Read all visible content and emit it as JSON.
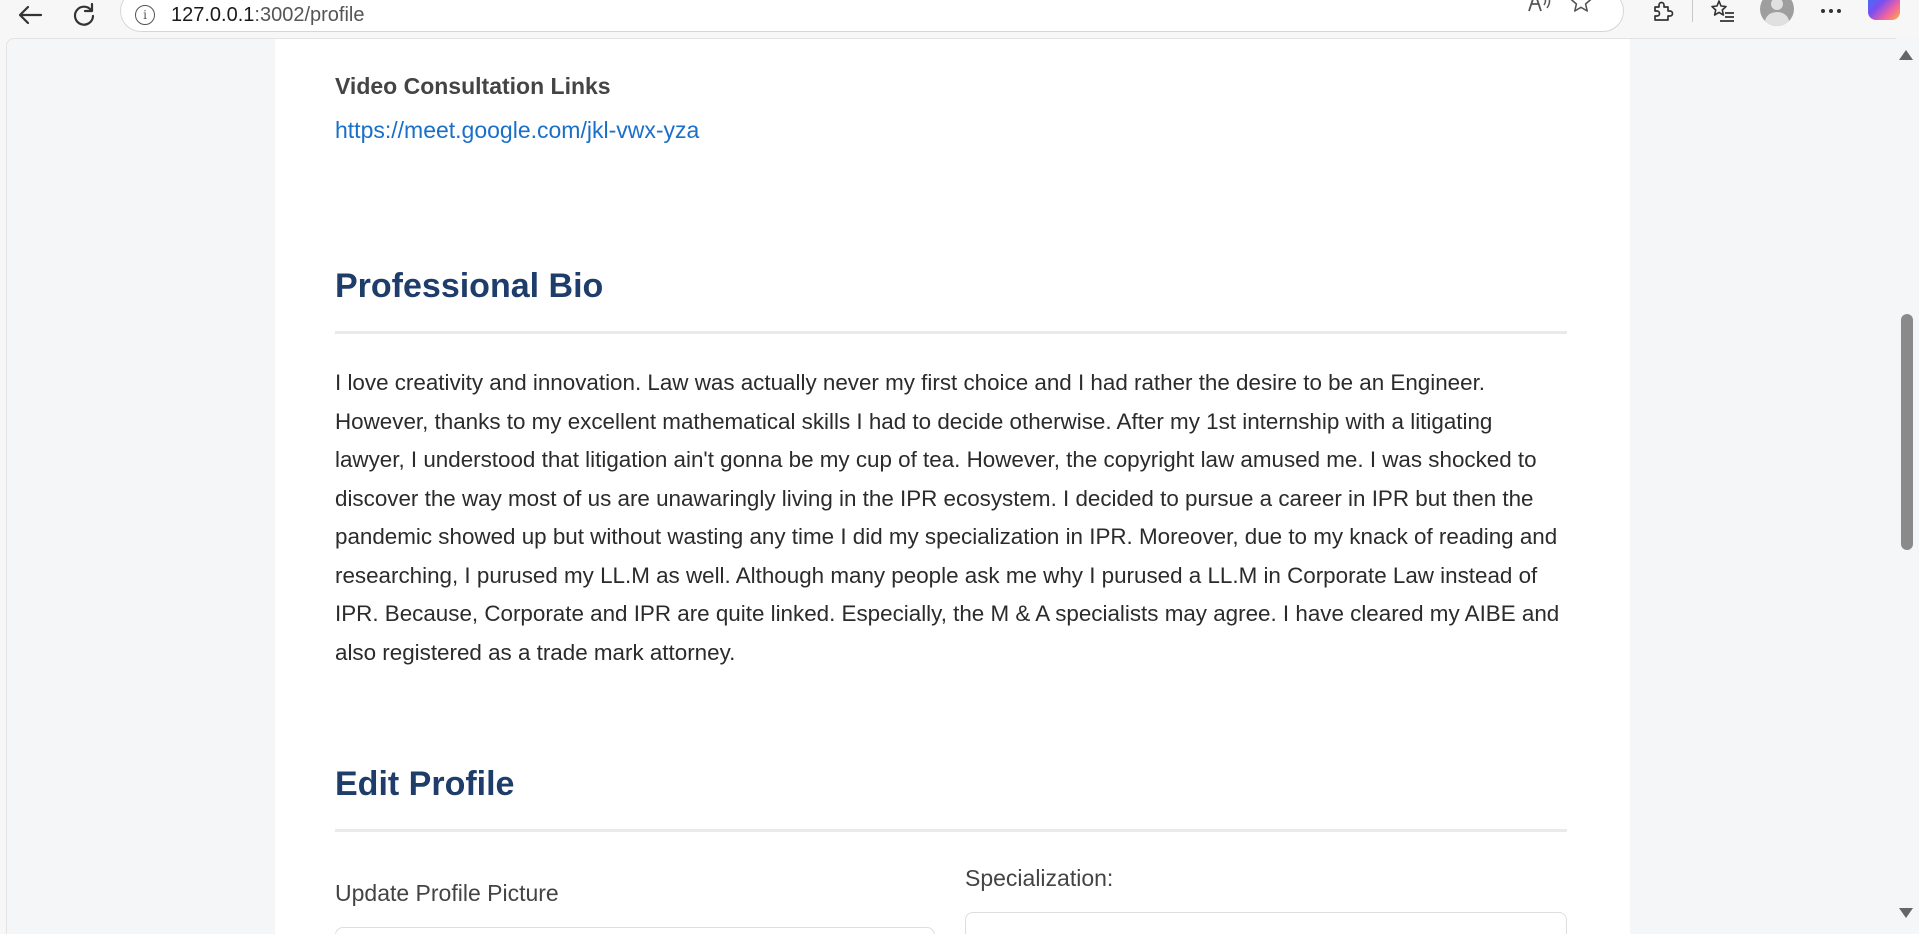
{
  "browser": {
    "url_host": "127.0.0.1",
    "url_path": ":3002/profile",
    "icons": {
      "back": "back-arrow-icon",
      "reload": "reload-icon",
      "site_info": "info-icon",
      "read_aloud": "read-aloud-icon",
      "favorite": "star-icon",
      "extensions": "puzzle-icon",
      "favorites_list": "favorites-icon",
      "profile": "avatar-icon",
      "menu": "more-icon",
      "copilot": "copilot-icon"
    }
  },
  "video_consultation": {
    "title": "Video Consultation Links",
    "link": "https://meet.google.com/jkl-vwx-yza"
  },
  "professional_bio": {
    "title": "Professional Bio",
    "text": "I love creativity and innovation. Law was actually never my first choice and I had rather the desire to be an Engineer. However, thanks to my excellent mathematical skills I had to decide otherwise. After my 1st internship with a litigating lawyer, I understood that litigation ain't gonna be my cup of tea. However, the copyright law amused me. I was shocked to discover the way most of us are unawaringly living in the IPR ecosystem. I decided to pursue a career in IPR but then the pandemic showed up but without wasting any time I did my specialization in IPR. Moreover, due to my knack of reading and researching, I purused my LL.M as well. Although many people ask me why I purused a LL.M in Corporate Law instead of IPR. Because, Corporate and IPR are quite linked. Especially, the M & A specialists may agree. I have cleared my AIBE and also registered as a trade mark attorney."
  },
  "edit_profile": {
    "title": "Edit Profile",
    "update_picture_label": "Update Profile Picture",
    "specialization_label": "Specialization:"
  },
  "colors": {
    "heading": "#1f3d6b",
    "link": "#1a6fc9",
    "text": "#2b2b2b"
  }
}
